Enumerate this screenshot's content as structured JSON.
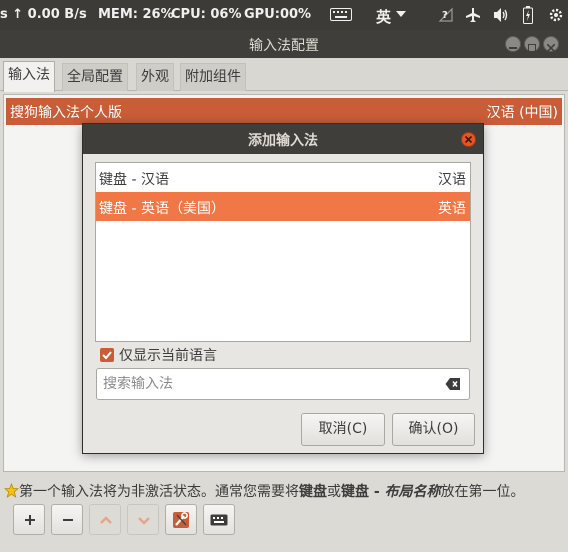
{
  "panel": {
    "net": "s ↑   0.00 B/s",
    "mem": "MEM: 26%",
    "cpu": "CPU: 06%",
    "gpu": "GPU:00%",
    "lang": "英"
  },
  "window": {
    "title": "输入法配置",
    "tabs": [
      "输入法",
      "全局配置",
      "外观",
      "附加组件"
    ]
  },
  "im_list": [
    {
      "name": "搜狗输入法个人版",
      "lang": "汉语 (中国)"
    }
  ],
  "dialog": {
    "title": "添加输入法",
    "items": [
      {
        "name": "键盘 - 汉语",
        "lang": "汉语"
      },
      {
        "name": "键盘 - 英语（美国）",
        "lang": "英语"
      }
    ],
    "only_current_lang_label": "仅显示当前语言",
    "only_current_lang_checked": true,
    "search_placeholder": "搜索输入法",
    "cancel_label": "取消(C)",
    "ok_label": "确认(O)"
  },
  "info": {
    "p1": "第一个输入法将为非激活状态。通常您需要将",
    "b1": "键盘",
    "p2": "或",
    "b2": "键盘 - ",
    "i1": "布局名称",
    "p3": "放在第一位。"
  },
  "colors": {
    "accent": "#f07746",
    "selection_row": "#c85d37",
    "close": "#e95420"
  }
}
